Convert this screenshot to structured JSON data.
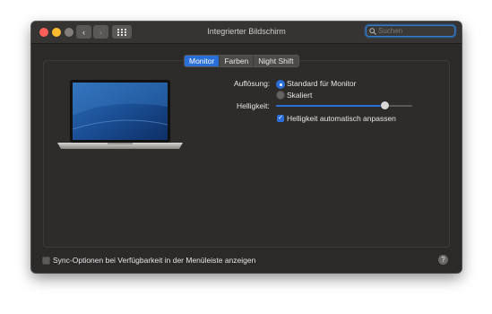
{
  "window": {
    "title": "Integrierter Bildschirm"
  },
  "toolbar": {
    "back_icon": "‹",
    "forward_icon": "›",
    "grid_icon": "⠿"
  },
  "search": {
    "placeholder": "Suchen",
    "icon": "⚲"
  },
  "tabs": [
    {
      "label": "Monitor",
      "active": true
    },
    {
      "label": "Farben",
      "active": false
    },
    {
      "label": "Night Shift",
      "active": false
    }
  ],
  "display": {
    "resolution_label": "Auflösung:",
    "resolution_options": [
      {
        "label": "Standard für Monitor",
        "selected": true
      },
      {
        "label": "Skaliert",
        "selected": false
      }
    ],
    "brightness_label": "Helligkeit:",
    "brightness_value": 0.8,
    "auto_brightness_label": "Helligkeit automatisch anpassen",
    "auto_brightness_checked": true
  },
  "footer": {
    "sync_label": "Sync-Optionen bei Verfügbarkeit in der Menüleiste anzeigen",
    "sync_checked": false,
    "help_label": "?"
  },
  "colors": {
    "accent": "#2a6fd9",
    "window_bg": "#2c2a29"
  }
}
